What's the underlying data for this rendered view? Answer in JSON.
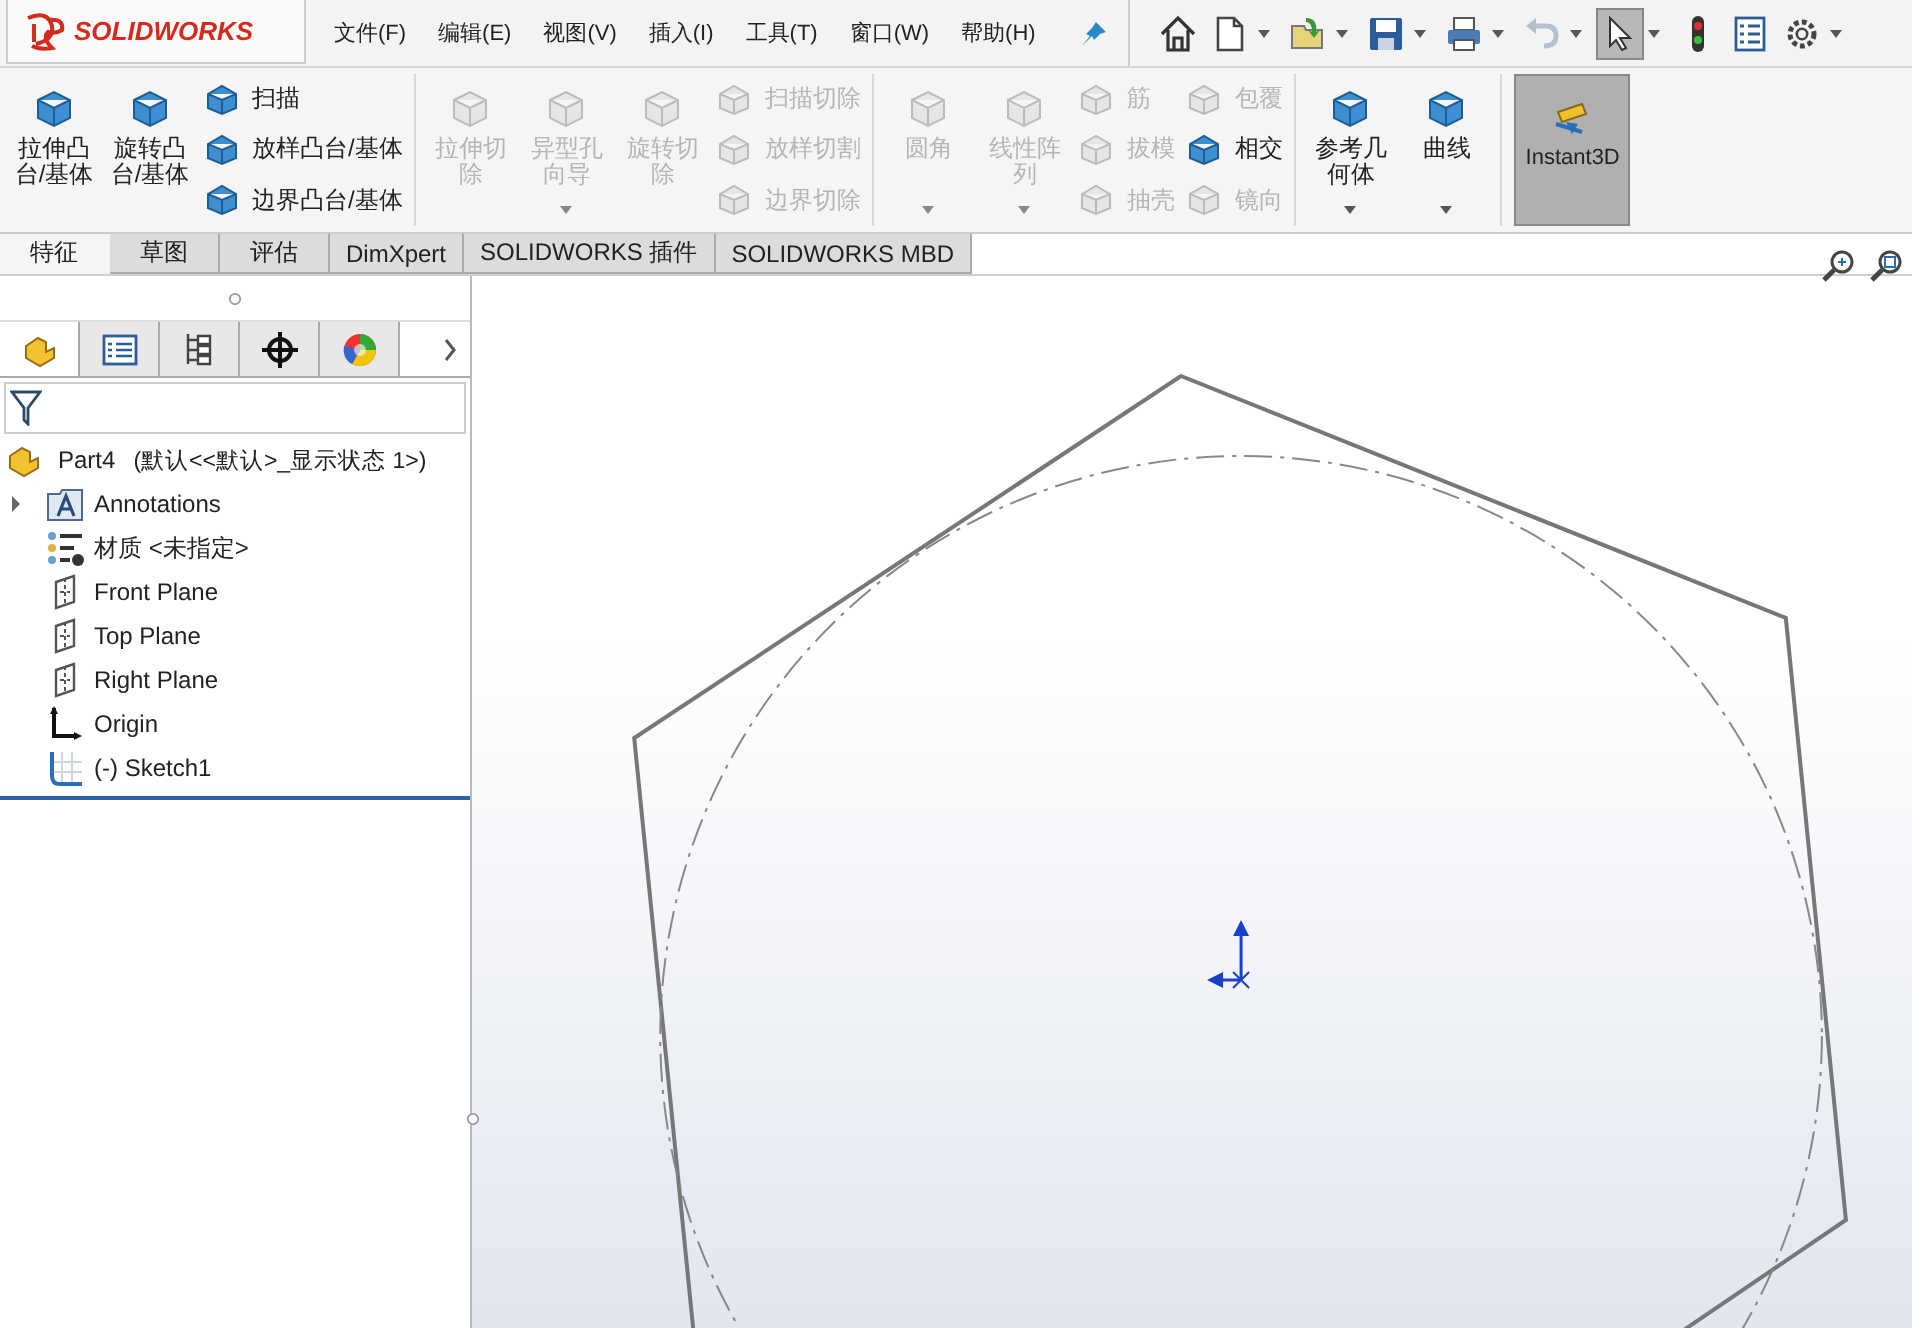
{
  "app": {
    "logo": "SOLIDWORKS"
  },
  "menu": [
    {
      "label": "文件(F)"
    },
    {
      "label": "编辑(E)"
    },
    {
      "label": "视图(V)"
    },
    {
      "label": "插入(I)"
    },
    {
      "label": "工具(T)"
    },
    {
      "label": "窗口(W)"
    },
    {
      "label": "帮助(H)"
    }
  ],
  "toolbar": [
    {
      "kind": "home",
      "dropdown": false,
      "disabled": false,
      "selected": false
    },
    {
      "kind": "new",
      "dropdown": true,
      "disabled": false,
      "selected": false
    },
    {
      "kind": "open",
      "dropdown": true,
      "disabled": false,
      "selected": false
    },
    {
      "kind": "save",
      "dropdown": true,
      "disabled": false,
      "selected": false
    },
    {
      "kind": "print",
      "dropdown": true,
      "disabled": false,
      "selected": false
    },
    {
      "kind": "undo",
      "dropdown": true,
      "disabled": true,
      "selected": false
    },
    {
      "kind": "select",
      "dropdown": true,
      "disabled": false,
      "selected": true
    },
    {
      "kind": "rebuild",
      "dropdown": false,
      "disabled": false,
      "selected": false
    },
    {
      "kind": "options-list",
      "dropdown": false,
      "disabled": false,
      "selected": false
    },
    {
      "kind": "settings",
      "dropdown": true,
      "disabled": false,
      "selected": false
    }
  ],
  "ribbon": {
    "groups": [
      {
        "columns": [
          {
            "kind": "big",
            "label": "拉伸凸台/基体",
            "disabled": false,
            "dropdown": false
          },
          {
            "kind": "big",
            "label": "旋转凸台/基体",
            "disabled": false,
            "dropdown": false
          },
          {
            "kind": "stack",
            "items": [
              {
                "label": "扫描",
                "disabled": false
              },
              {
                "label": "放样凸台/基体",
                "disabled": false
              },
              {
                "label": "边界凸台/基体",
                "disabled": false
              }
            ]
          }
        ]
      },
      {
        "columns": [
          {
            "kind": "big",
            "label": "拉伸切除",
            "disabled": true,
            "dropdown": false
          },
          {
            "kind": "big",
            "label": "异型孔向导",
            "disabled": true,
            "dropdown": true
          },
          {
            "kind": "big",
            "label": "旋转切除",
            "disabled": true,
            "dropdown": false
          },
          {
            "kind": "stack",
            "items": [
              {
                "label": "扫描切除",
                "disabled": true
              },
              {
                "label": "放样切割",
                "disabled": true
              },
              {
                "label": "边界切除",
                "disabled": true
              }
            ]
          }
        ]
      },
      {
        "columns": [
          {
            "kind": "big",
            "label": "圆角",
            "disabled": true,
            "dropdown": true
          },
          {
            "kind": "big",
            "label": "线性阵列",
            "disabled": true,
            "dropdown": true
          },
          {
            "kind": "stack",
            "items": [
              {
                "label": "筋",
                "disabled": true
              },
              {
                "label": "拔模",
                "disabled": true
              },
              {
                "label": "抽壳",
                "disabled": true
              }
            ]
          },
          {
            "kind": "stack",
            "items": [
              {
                "label": "包覆",
                "disabled": true
              },
              {
                "label": "相交",
                "disabled": false
              },
              {
                "label": "镜向",
                "disabled": true
              }
            ]
          }
        ]
      },
      {
        "columns": [
          {
            "kind": "big",
            "label": "参考几何体",
            "disabled": false,
            "dropdown": true
          },
          {
            "kind": "big",
            "label": "曲线",
            "disabled": false,
            "dropdown": true
          }
        ]
      },
      {
        "columns": [
          {
            "kind": "toggle",
            "label": "Instant3D",
            "selected": true
          }
        ]
      }
    ]
  },
  "tabs": [
    {
      "label": "特征",
      "selected": true
    },
    {
      "label": "草图",
      "selected": false
    },
    {
      "label": "评估",
      "selected": false
    },
    {
      "label": "DimXpert",
      "selected": false
    },
    {
      "label": "SOLIDWORKS 插件",
      "selected": false
    },
    {
      "label": "SOLIDWORKS MBD",
      "selected": false
    }
  ],
  "panel_tabs": [
    {
      "kind": "feature-tree",
      "selected": true
    },
    {
      "kind": "property",
      "selected": false
    },
    {
      "kind": "config",
      "selected": false
    },
    {
      "kind": "dimxpert",
      "selected": false
    },
    {
      "kind": "display",
      "selected": false
    }
  ],
  "tree": {
    "label": "Part4",
    "suffix": "(默认<<默认>_显示状态 1>)",
    "children": [
      {
        "kind": "annotations",
        "label": "Annotations",
        "expandable": true
      },
      {
        "kind": "material",
        "label": "材质 <未指定>",
        "expandable": false
      },
      {
        "kind": "plane",
        "label": "Front Plane",
        "expandable": false
      },
      {
        "kind": "plane",
        "label": "Top Plane",
        "expandable": false
      },
      {
        "kind": "plane",
        "label": "Right Plane",
        "expandable": false
      },
      {
        "kind": "origin",
        "label": "Origin",
        "expandable": false
      },
      {
        "kind": "sketch",
        "label": "(-) Sketch1",
        "expandable": false
      }
    ]
  }
}
